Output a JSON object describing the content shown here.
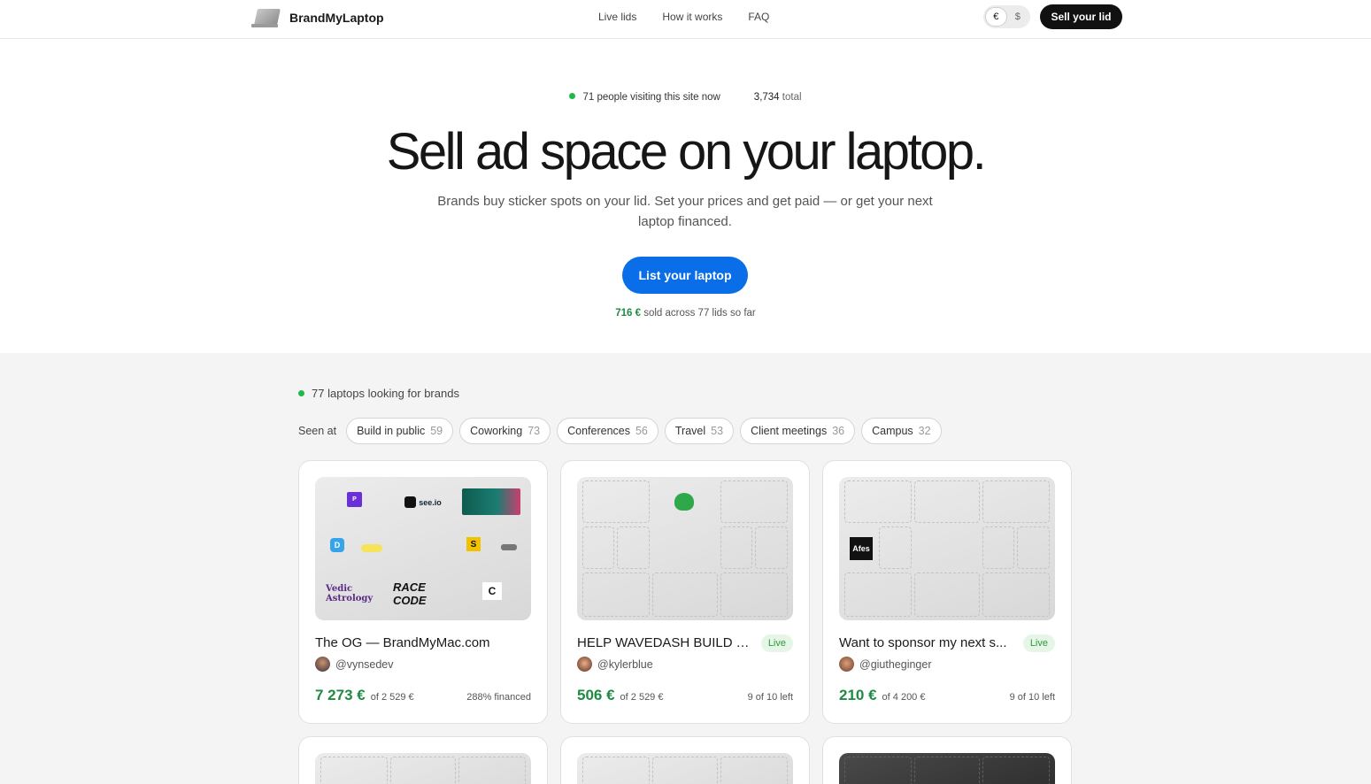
{
  "header": {
    "brand": "BrandMyLaptop",
    "nav": [
      "Live lids",
      "How it works",
      "FAQ"
    ],
    "currency": [
      "€",
      "$"
    ],
    "sell_button": "Sell your lid"
  },
  "hero": {
    "visitors": "71 people visiting this site now",
    "total_num": "3,734",
    "total_label": "total",
    "title": "Sell ad space on your laptop.",
    "subtitle": "Brands buy sticker spots on your lid. Set your prices and get paid — or get your next laptop financed.",
    "cta": "List your laptop",
    "sold_amount": "716 €",
    "sold_rest": "sold across 77 lids so far"
  },
  "listing": {
    "count_text": "77 laptops looking for brands",
    "seen_at": "Seen at",
    "filters": [
      {
        "label": "Build in public",
        "count": "59"
      },
      {
        "label": "Coworking",
        "count": "73"
      },
      {
        "label": "Conferences",
        "count": "56"
      },
      {
        "label": "Travel",
        "count": "53"
      },
      {
        "label": "Client meetings",
        "count": "36"
      },
      {
        "label": "Campus",
        "count": "32"
      }
    ]
  },
  "cards": [
    {
      "title": "The OG — BrandMyMac.com",
      "badge": "",
      "handle": "@vynsedev",
      "raised": "7 273 €",
      "goal": "of 2 529 €",
      "note": "288% financed"
    },
    {
      "title": "HELP WAVEDASH BUILD T...",
      "badge": "Live",
      "handle": "@kylerblue",
      "raised": "506 €",
      "goal": "of 2 529 €",
      "note": "9 of 10 left"
    },
    {
      "title": "Want to sponsor my next s...",
      "badge": "Live",
      "handle": "@giutheginger",
      "raised": "210 €",
      "goal": "of 4 200 €",
      "note": "9 of 10 left"
    }
  ],
  "stickers": {
    "seeio": "see.io",
    "afes": "Afes",
    "race": "RACE CODE",
    "vedic": "Vedic Astrology"
  },
  "colors": {
    "accent_blue": "#0a6ee8",
    "money_green": "#1e8a44",
    "live_dot": "#1fb84a"
  }
}
